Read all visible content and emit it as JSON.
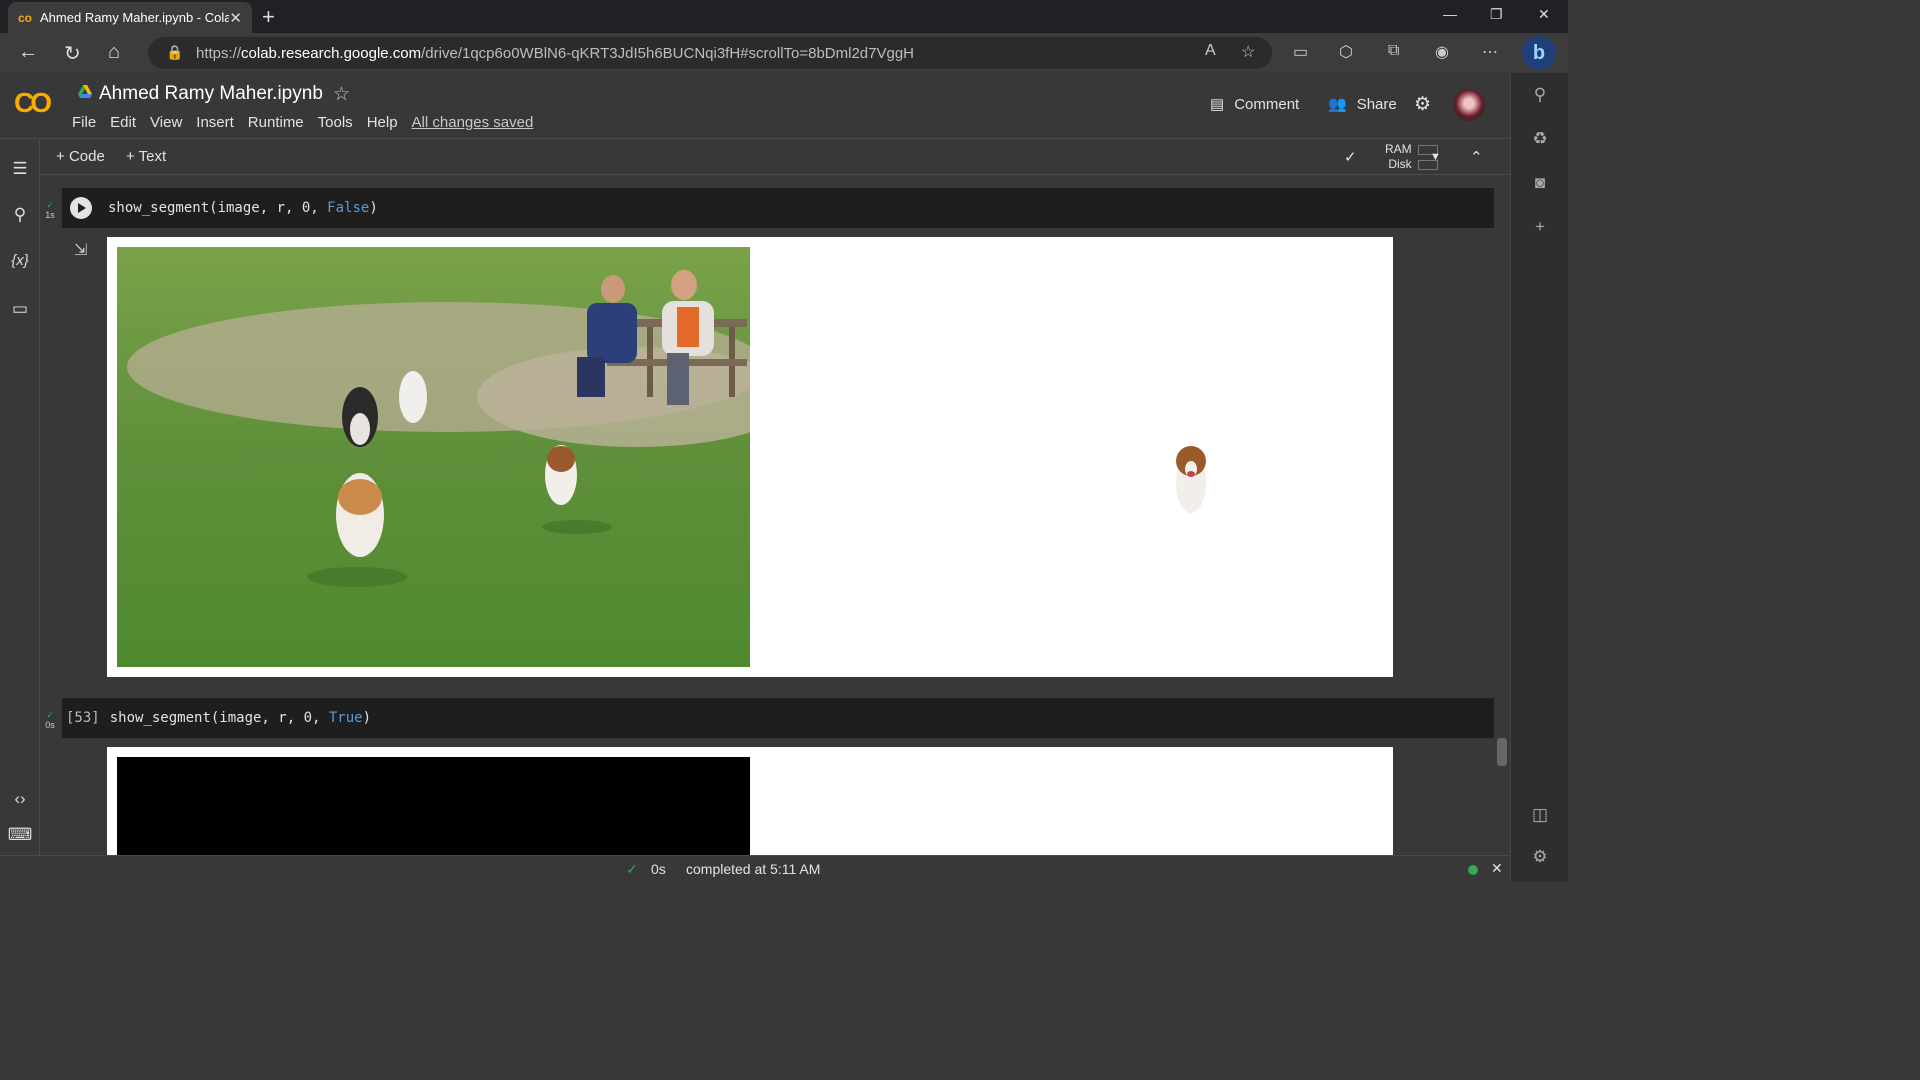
{
  "browser": {
    "tab_title": "Ahmed Ramy Maher.ipynb - Cola",
    "url_prefix": "https://",
    "url_host": "colab.research.google.com",
    "url_path": "/drive/1qcp6o0WBlN6-qKRT3JdI5h6BUCNqi3fH#scrollTo=8bDml2d7VggH"
  },
  "colab": {
    "notebook_title": "Ahmed Ramy Maher.ipynb",
    "menu": [
      "File",
      "Edit",
      "View",
      "Insert",
      "Runtime",
      "Tools",
      "Help"
    ],
    "save_status": "All changes saved",
    "comment_label": "Comment",
    "share_label": "Share",
    "add_code_label": "Code",
    "add_text_label": "Text",
    "ram_label": "RAM",
    "disk_label": "Disk"
  },
  "cells": [
    {
      "exec_label": "",
      "time": "1s",
      "code_prefix": "show_segment(image, r, 0, ",
      "code_kw": "False",
      "code_suffix": ")"
    },
    {
      "exec_label": "[53]",
      "time": "0s",
      "code_prefix": "show_segment(image, r, 0, ",
      "code_kw": "True",
      "code_suffix": ")"
    }
  ],
  "status": {
    "duration": "0s",
    "completed": "completed at 5:11 AM"
  },
  "colors": {
    "accent": "#f9ab00",
    "ok": "#34a853",
    "keyword": "#569cd6"
  }
}
